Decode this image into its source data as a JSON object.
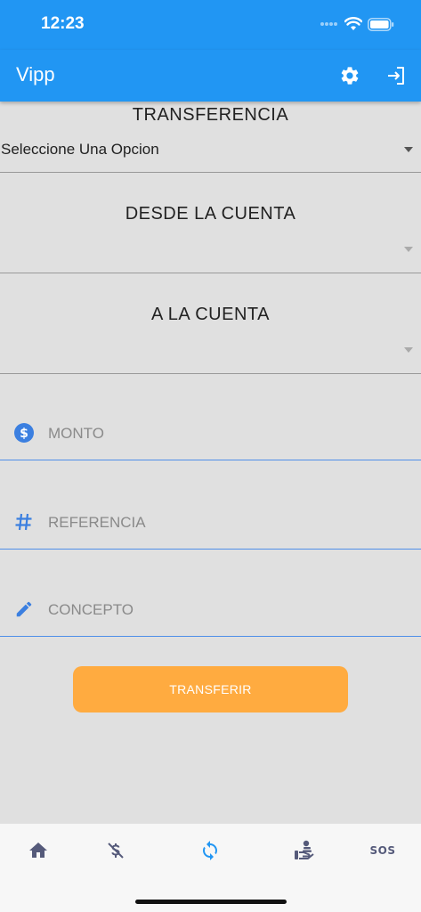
{
  "status_bar": {
    "time": "12:23"
  },
  "app_bar": {
    "title": "Vipp"
  },
  "form": {
    "transfer_type_label": "TRANSFERENCIA",
    "transfer_type_value": "Seleccione Una Opcion",
    "from_account_label": "DESDE LA CUENTA",
    "to_account_label": "A LA CUENTA",
    "amount_placeholder": "MONTO",
    "reference_placeholder": "REFERENCIA",
    "concept_placeholder": "CONCEPTO",
    "submit_label": "TRANSFERIR"
  },
  "bottom_nav": {
    "items": [
      {
        "icon": "home-icon"
      },
      {
        "icon": "money-off-icon"
      },
      {
        "icon": "sync-icon",
        "active": true
      },
      {
        "icon": "hand-coins-icon"
      },
      {
        "label": "SOS"
      }
    ]
  },
  "colors": {
    "primary": "#2196f3",
    "accent_button": "#ffab40",
    "field_underline": "#4f8fe8",
    "nav_icon": "#555a7a",
    "nav_active": "#2196f3"
  }
}
